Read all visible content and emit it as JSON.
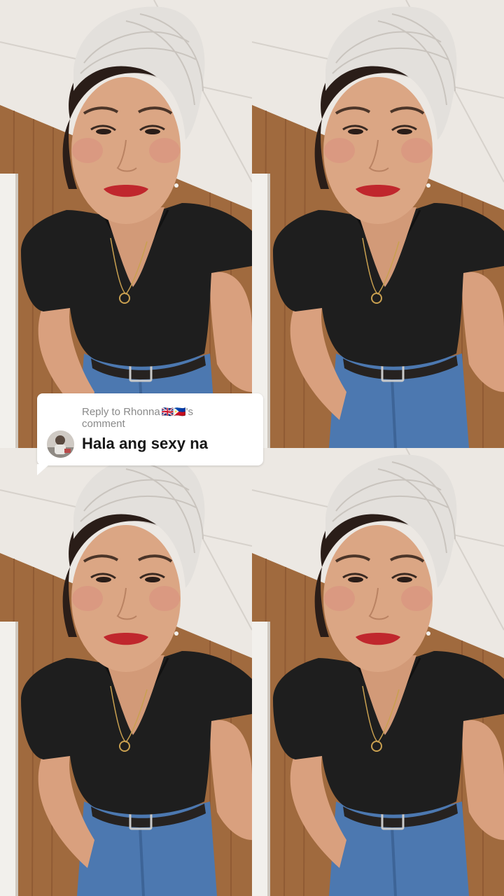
{
  "video": {
    "layout": "2x2 duplicated frame",
    "tiles": 4
  },
  "reply_bubble": {
    "prefix": "Reply to Rhonna",
    "flags": "🇬🇧🇵🇭",
    "suffix": "'s",
    "suffix_line2": "comment",
    "comment_text": "Hala ang sexy na",
    "avatar_icon": "avatar"
  },
  "colors": {
    "bubble_bg": "#ffffff",
    "header_text": "#8a8a8a",
    "comment_text": "#161616",
    "wall_wood": "#a06a3e",
    "ceiling": "#ece8e3",
    "shirt": "#1e1e1e",
    "towel": "#e3e0dc",
    "jeans": "#4c78b0"
  }
}
